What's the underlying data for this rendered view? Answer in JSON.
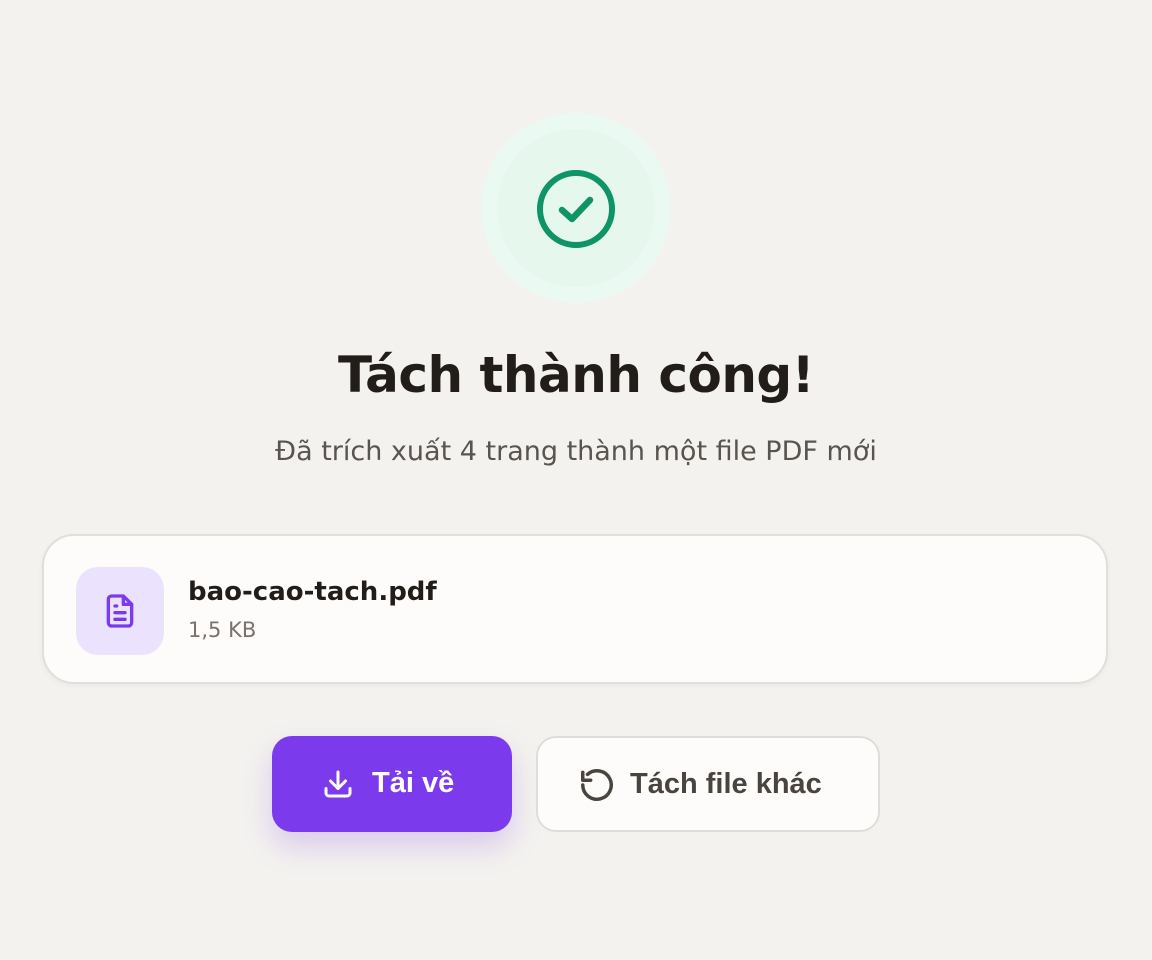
{
  "result": {
    "title": "Tách thành công!",
    "subtitle": "Đã trích xuất 4 trang thành một file PDF mới"
  },
  "file": {
    "icon": "document-icon",
    "name": "bao-cao-tach.pdf",
    "size": "1,5 KB"
  },
  "actions": {
    "download_label": "Tải về",
    "download_icon": "download-icon",
    "again_label": "Tách file khác",
    "again_icon": "rotate-ccw-icon"
  },
  "colors": {
    "accent": "#7c3aed",
    "success": "#0e9467",
    "success_bg": "#eafaf2",
    "background": "#f4f2ef",
    "text": "#221d19"
  }
}
